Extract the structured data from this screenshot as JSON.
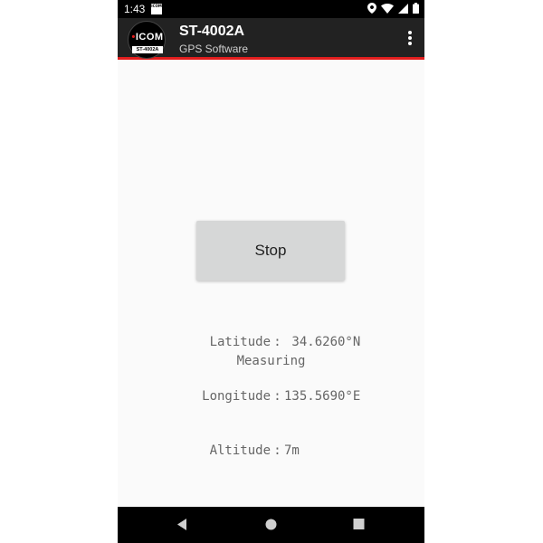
{
  "status_bar": {
    "time": "1:43",
    "notification_icon": "icom-notification-icon",
    "icons": [
      "location-icon",
      "wifi-icon",
      "signal-icon",
      "battery-icon"
    ]
  },
  "toolbar": {
    "logo_text": "ICOM",
    "logo_model": "ST-4002A",
    "title": "ST-4002A",
    "subtitle": "GPS Software",
    "menu_icon": "overflow-menu-icon",
    "accent_color": "#e31e1e"
  },
  "main": {
    "stop_button_label": "Stop",
    "readout": [
      {
        "label": "Latitude",
        "sep": ":",
        "value": " 34.6260°N"
      },
      {
        "label": "Longitude",
        "sep": ":",
        "value": "135.5690°E"
      },
      {
        "label": "Altitude",
        "sep": ":",
        "value": "7m"
      }
    ],
    "status": "Measuring"
  },
  "nav_bar": {
    "buttons": [
      "back-icon",
      "home-icon",
      "recents-icon"
    ]
  }
}
